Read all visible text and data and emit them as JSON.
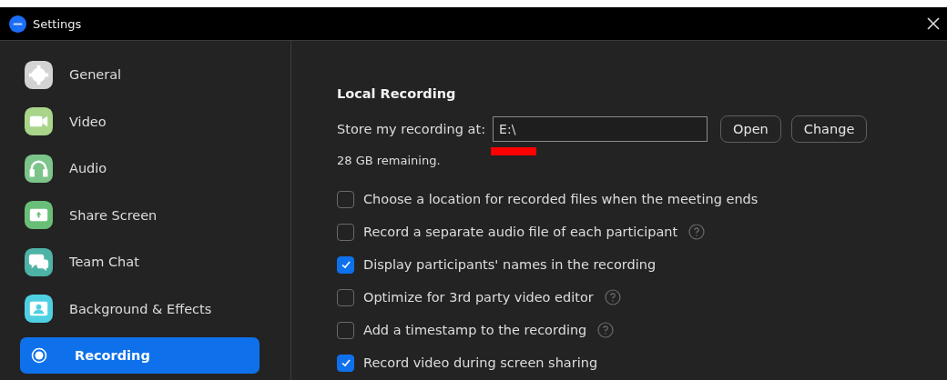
{
  "window": {
    "title": "Settings"
  },
  "sidebar": {
    "items": [
      {
        "label": "General",
        "kind": "gear",
        "color": "#d3d3d3",
        "selected": false
      },
      {
        "label": "Video",
        "kind": "camera",
        "color": "#a8d58a",
        "selected": false
      },
      {
        "label": "Audio",
        "kind": "headphones",
        "color": "#7cc48a",
        "selected": false
      },
      {
        "label": "Share Screen",
        "kind": "share",
        "color": "#6abf78",
        "selected": false
      },
      {
        "label": "Team Chat",
        "kind": "chat",
        "color": "#4db3a6",
        "selected": false
      },
      {
        "label": "Background & Effects",
        "kind": "person",
        "color": "#4fd0e2",
        "selected": false
      },
      {
        "label": "Recording",
        "kind": "record",
        "color": "#ffffff",
        "selected": true
      }
    ]
  },
  "local_recording": {
    "heading": "Local Recording",
    "store_label": "Store my recording at:",
    "path_value": "E:\\",
    "open_button": "Open",
    "change_button": "Change",
    "remaining": "28 GB remaining."
  },
  "options": [
    {
      "label": "Choose a location for recorded files when the meeting ends",
      "checked": false,
      "help": false
    },
    {
      "label": "Record a separate audio file of each participant",
      "checked": false,
      "help": true
    },
    {
      "label": "Display participants' names in the recording",
      "checked": true,
      "help": false
    },
    {
      "label": "Optimize for 3rd party video editor",
      "checked": false,
      "help": true
    },
    {
      "label": "Add a timestamp to the recording",
      "checked": false,
      "help": true
    },
    {
      "label": "Record video during screen sharing",
      "checked": true,
      "help": false
    }
  ]
}
